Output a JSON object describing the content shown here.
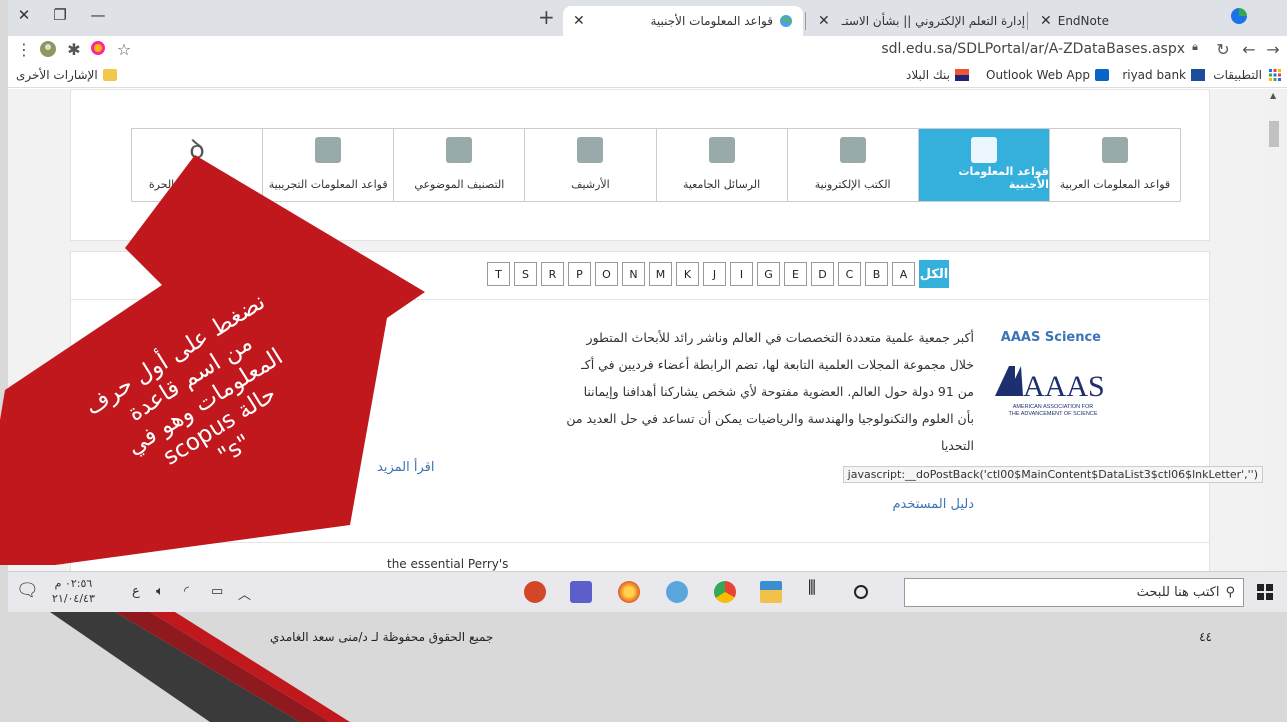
{
  "browser": {
    "tabs": [
      {
        "title": "EndNote",
        "icon": "endnote-icon"
      },
      {
        "title": "إدارة التعلم الإلكتروني || بشأن الاستـ",
        "icon": "gmail-icon"
      },
      {
        "title": "قواعد المعلومات الأجنبية",
        "icon": "globe-icon"
      }
    ],
    "url": "sdl.edu.sa/SDLPortal/ar/A-ZDataBases.aspx",
    "bookmarks": [
      {
        "label": "التطبيقات",
        "icon": "apps-grid-icon"
      },
      {
        "label": "riyad bank",
        "icon": "riyad-bank-icon"
      },
      {
        "label": "Outlook Web App",
        "icon": "outlook-icon"
      },
      {
        "label": "بنك البلاد",
        "icon": "albilad-icon"
      }
    ],
    "other_bookmarks": "الإشارات الأخرى"
  },
  "categories": [
    {
      "label": "قواعد المعلومات العربية",
      "icon": "arabic-db-icon",
      "active": false
    },
    {
      "label": "قواعد المعلومات الأجنبية",
      "icon": "foreign-db-icon",
      "active": true
    },
    {
      "label": "الكتب الإلكترونية",
      "icon": "ebook-icon",
      "active": false
    },
    {
      "label": "الرسائل الجامعية",
      "icon": "theses-icon",
      "active": false
    },
    {
      "label": "الأرشيف",
      "icon": "archive-icon",
      "active": false
    },
    {
      "label": "التصنيف الموضوعي",
      "icon": "subject-tree-icon",
      "active": false
    },
    {
      "label": "قواعد المعلومات التجريبية",
      "icon": "trial-db-icon",
      "active": false
    },
    {
      "label": "محرك المصادر الحرة",
      "icon": "open-resources-icon",
      "active": false
    }
  ],
  "letters": {
    "all": "الكل",
    "items": [
      "A",
      "B",
      "C",
      "D",
      "E",
      "G",
      "I",
      "J",
      "K",
      "M",
      "N",
      "O",
      "P",
      "R",
      "S",
      "T"
    ]
  },
  "database": {
    "title": "AAAS Science",
    "logo_text": "AAAS",
    "logo_subtitle_1": "AMERICAN ASSOCIATION FOR",
    "logo_subtitle_2": "THE ADVANCEMENT OF SCIENCE",
    "description_lines": [
      "أكبر جمعية علمية متعددة التخصصات في العالم وناشر رائد للأبحاث المتطور",
      "خلال مجموعة المجلات العلمية التابعة لها، تضم الرابطة أعضاء فرديين في أكـ",
      "من 91 دولة حول العالم. العضوية مفتوحة لأي شخص يشاركنا أهدافنا وإيماننا",
      "بأن العلوم والتكنولوجيا والهندسة والرياضيات يمكن أن تساعد في حل العديد من",
      "التحديا"
    ],
    "read_more": "اقرأ المزيد",
    "user_guide": "دليل المستخدم",
    "next_row_fragment": "the essential Perry's"
  },
  "status_bar_url": "javascript:__doPostBack('ctl00$MainContent$DataList3$ctl06$lnkLetter','')",
  "taskbar": {
    "search_placeholder": "اكتب هنا للبحث",
    "time": "٠٢:٥٦ م",
    "date": "٢١/٠٤/٤٣",
    "lang": "ع"
  },
  "annotation": {
    "lines": [
      "نضغط على أول حرف",
      "من اسم قاعدة",
      "المعلومات وهو في",
      "حالة scopus",
      "\"s\""
    ],
    "color": "#c0181d"
  },
  "slide": {
    "credit": "جميع الحقوق محفوظة لـ د/منى سعد الغامدي",
    "page_number": "٤٤"
  },
  "colors": {
    "accent": "#35b0dc",
    "link": "#3b74b7"
  }
}
